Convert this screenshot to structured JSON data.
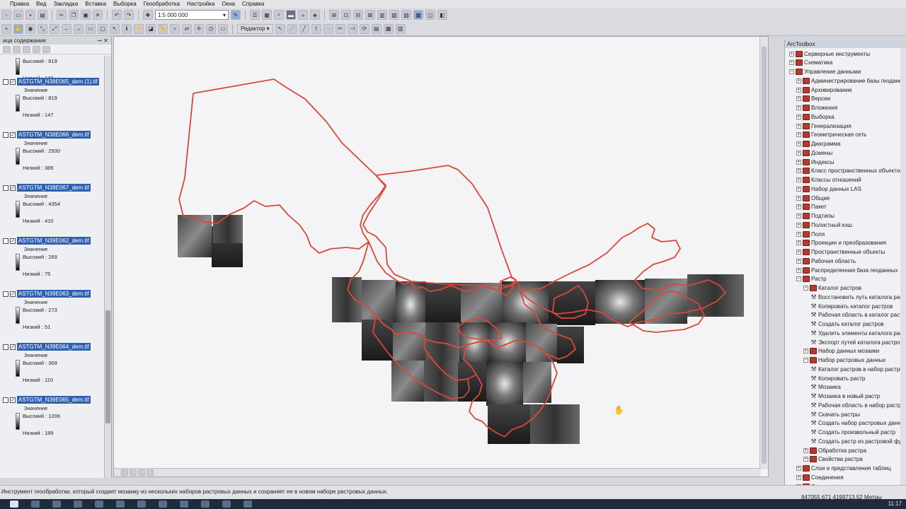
{
  "menu": [
    "Правка",
    "Вид",
    "Закладка",
    "Вставка",
    "Выборка",
    "Геообработка",
    "Настройка",
    "Окна",
    "Справка"
  ],
  "toolbar": {
    "scale": "1:5 000 000",
    "editor_label": "Редактор"
  },
  "toc": {
    "title": "ица содержания",
    "layers": [
      {
        "name": "",
        "value_label": "Значение",
        "high": "Высокий : 819",
        "low": "Низкий : 147",
        "partial": true
      },
      {
        "name": "ASTGTM_N38E065_dem (1).tif",
        "value_label": "Значение",
        "high": "Высокий : 819",
        "low": "Низкий : 147"
      },
      {
        "name": "ASTGTM_N38E066_dem.tif",
        "value_label": "Значение",
        "high": "Высокий : 2930",
        "low": "Низкий : 389"
      },
      {
        "name": "ASTGTM_N38E067_dem.tif",
        "value_label": "Значение",
        "high": "Высокий : 4354",
        "low": "Низкий : 410"
      },
      {
        "name": "ASTGTM_N39E062_dem.tif",
        "value_label": "Значение",
        "high": "Высокий : 269",
        "low": "Низкий : 75"
      },
      {
        "name": "ASTGTM_N39E063_dem.tif",
        "value_label": "Значение",
        "high": "Высокий : 273",
        "low": "Низкий : 51"
      },
      {
        "name": "ASTGTM_N39E064_dem.tif",
        "value_label": "Значение",
        "high": "Высокий : 369",
        "low": "Низкий : 110"
      },
      {
        "name": "ASTGTM_N39E065_dem.tif",
        "value_label": "Значение",
        "high": "Высокий : 1206",
        "low": "Низкий : 189"
      }
    ]
  },
  "arctoolbox": {
    "title": "ArcToolbox",
    "items": [
      {
        "label": "Серверные инструменты",
        "level": 0,
        "kind": "box",
        "exp": "+"
      },
      {
        "label": "Схематика",
        "level": 0,
        "kind": "box",
        "exp": "+"
      },
      {
        "label": "Управление данными",
        "level": 0,
        "kind": "box",
        "exp": "−"
      },
      {
        "label": "Администрирование базы геоданных",
        "level": 1,
        "kind": "box",
        "exp": "+"
      },
      {
        "label": "Архивирование",
        "level": 1,
        "kind": "box",
        "exp": "+"
      },
      {
        "label": "Версии",
        "level": 1,
        "kind": "box",
        "exp": "+"
      },
      {
        "label": "Вложения",
        "level": 1,
        "kind": "box",
        "exp": "+"
      },
      {
        "label": "Выборка",
        "level": 1,
        "kind": "box",
        "exp": "+"
      },
      {
        "label": "Генерализация",
        "level": 1,
        "kind": "box",
        "exp": "+"
      },
      {
        "label": "Геометрическая сеть",
        "level": 1,
        "kind": "box",
        "exp": "+"
      },
      {
        "label": "Диаграмма",
        "level": 1,
        "kind": "box",
        "exp": "+"
      },
      {
        "label": "Домены",
        "level": 1,
        "kind": "box",
        "exp": "+"
      },
      {
        "label": "Индексы",
        "level": 1,
        "kind": "box",
        "exp": "+"
      },
      {
        "label": "Класс пространственных объектов",
        "level": 1,
        "kind": "box",
        "exp": "+"
      },
      {
        "label": "Классы отношений",
        "level": 1,
        "kind": "box",
        "exp": "+"
      },
      {
        "label": "Набор данных LAS",
        "level": 1,
        "kind": "box",
        "exp": "+"
      },
      {
        "label": "Общие",
        "level": 1,
        "kind": "box",
        "exp": "+"
      },
      {
        "label": "Пакет",
        "level": 1,
        "kind": "box",
        "exp": "+"
      },
      {
        "label": "Подтипы",
        "level": 1,
        "kind": "box",
        "exp": "+"
      },
      {
        "label": "Полистный кэш",
        "level": 1,
        "kind": "box",
        "exp": "+"
      },
      {
        "label": "Поля",
        "level": 1,
        "kind": "box",
        "exp": "+"
      },
      {
        "label": "Проекции и преобразования",
        "level": 1,
        "kind": "box",
        "exp": "+"
      },
      {
        "label": "Пространственные объекты",
        "level": 1,
        "kind": "box",
        "exp": "+"
      },
      {
        "label": "Рабочая область",
        "level": 1,
        "kind": "box",
        "exp": "+"
      },
      {
        "label": "Распределенная база геоданных",
        "level": 1,
        "kind": "box",
        "exp": "+"
      },
      {
        "label": "Растр",
        "level": 1,
        "kind": "box",
        "exp": "−"
      },
      {
        "label": "Каталог растров",
        "level": 2,
        "kind": "box",
        "exp": "−"
      },
      {
        "label": "Восстановить путь каталога растров",
        "level": 3,
        "kind": "tool"
      },
      {
        "label": "Копировать каталог растров",
        "level": 3,
        "kind": "tool"
      },
      {
        "label": "Рабочая область в каталог растров",
        "level": 3,
        "kind": "tool"
      },
      {
        "label": "Создать каталог растров",
        "level": 3,
        "kind": "tool"
      },
      {
        "label": "Удалить элементы каталога растров",
        "level": 3,
        "kind": "tool"
      },
      {
        "label": "Экспорт путей каталога растров",
        "level": 3,
        "kind": "tool"
      },
      {
        "label": "Набор данных мозаики",
        "level": 2,
        "kind": "box",
        "exp": "+"
      },
      {
        "label": "Набор растровых данных",
        "level": 2,
        "kind": "box",
        "exp": "−"
      },
      {
        "label": "Каталог растров в набор растровых данных",
        "level": 3,
        "kind": "tool"
      },
      {
        "label": "Копировать растр",
        "level": 3,
        "kind": "tool"
      },
      {
        "label": "Мозаика",
        "level": 3,
        "kind": "tool"
      },
      {
        "label": "Мозаика в новый растр",
        "level": 3,
        "kind": "tool"
      },
      {
        "label": "Рабочая область в набор растровых данных",
        "level": 3,
        "kind": "tool"
      },
      {
        "label": "Скачать растры",
        "level": 3,
        "kind": "tool"
      },
      {
        "label": "Создать набор растровых данных",
        "level": 3,
        "kind": "tool"
      },
      {
        "label": "Создать произвольный растр",
        "level": 3,
        "kind": "tool"
      },
      {
        "label": "Создать растр из растровой функции",
        "level": 3,
        "kind": "tool"
      },
      {
        "label": "Обработка растра",
        "level": 2,
        "kind": "box",
        "exp": "+"
      },
      {
        "label": "Свойства растра",
        "level": 2,
        "kind": "box",
        "exp": "+"
      },
      {
        "label": "Слои и представления таблиц",
        "level": 1,
        "kind": "box",
        "exp": "+"
      },
      {
        "label": "Соединения",
        "level": 1,
        "kind": "box",
        "exp": "+"
      },
      {
        "label": "Сравнение данных",
        "level": 1,
        "kind": "box",
        "exp": "+"
      }
    ]
  },
  "status": {
    "message": "Инструмент геообработки, который создает мозаику из нескольких наборов растровых данных и сохраняет ее в новом наборе растровых данных.",
    "coords": "847055,671  4199713,52 Метры"
  },
  "taskbar": {
    "clock": "11:17"
  },
  "colors": {
    "boundary": "#d9483a",
    "selection": "#2f5fb0"
  }
}
